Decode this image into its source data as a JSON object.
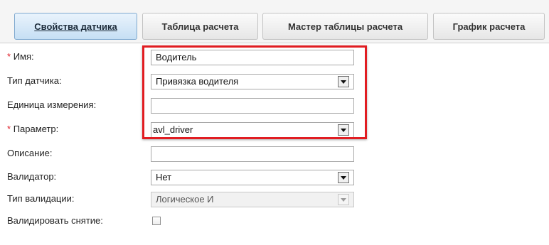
{
  "tabs": [
    {
      "label": "Свойства датчика",
      "active": true
    },
    {
      "label": "Таблица расчета",
      "active": false
    },
    {
      "label": "Мастер таблицы расчета",
      "active": false
    },
    {
      "label": "График расчета",
      "active": false
    }
  ],
  "form": {
    "required_mark": "*",
    "name": {
      "label": "Имя:",
      "value": "Водитель"
    },
    "sensor_type": {
      "label": "Тип датчика:",
      "value": "Привязка водителя"
    },
    "unit": {
      "label": "Единица измерения:",
      "value": ""
    },
    "parameter": {
      "label": "Параметр:",
      "value": "avl_driver"
    },
    "description": {
      "label": "Описание:",
      "value": ""
    },
    "validator": {
      "label": "Валидатор:",
      "value": "Нет"
    },
    "validation_type": {
      "label": "Тип валидации:",
      "value": "Логическое И",
      "disabled": true
    },
    "validate_removal": {
      "label": "Валидировать снятие:",
      "checked": false
    }
  },
  "colors": {
    "active_tab_bg": "#c6dff4",
    "required_mark": "#e0202a",
    "highlight_border": "#e11d22"
  }
}
